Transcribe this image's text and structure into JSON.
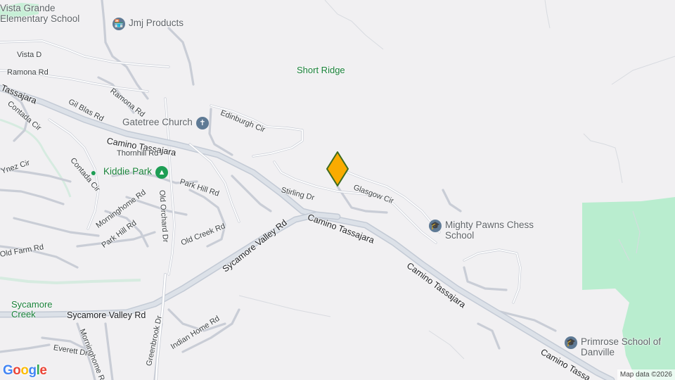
{
  "map": {
    "colors": {
      "background": "#f1f0f2",
      "road": "#ffffff",
      "road_casing": "#c9cdd6",
      "major_road": "#c9d0da",
      "park": "#b9edcf",
      "stream": "#d6ebe0",
      "marker_fill": "#f9ab00",
      "marker_stroke": "#3e6b1f"
    },
    "streets": {
      "vista": "Vista D",
      "ramona1": "Ramona Rd",
      "tassajara_top": "Tassajara",
      "contada1": "Contada Cir",
      "gil_blas": "Gil Blas Rd",
      "ramona2": "Ramona Rd",
      "edinburgh": "Edinburgh Cir",
      "tassajara_west": "Camino Tassajara",
      "thornhill": "Thornhill Rd",
      "contada2": "Contada Cir",
      "ynez": "Ynez Cir",
      "park_hill1": "Park Hill Rd",
      "stirling": "Stirling Dr",
      "glasgow": "Glasgow Cir",
      "tassajara_mid": "Camino Tassajara",
      "sycamore_valley_diag": "Sycamore Valley Rd",
      "morninghome1": "Morninghome Rd",
      "old_orchard": "Old Orchard Dr",
      "park_hill2": "Park Hill Rd",
      "old_creek": "Old Creek Rd",
      "old_farm": "Old Farm Rd",
      "tassajara_east": "Camino Tassajara",
      "sycamore_valley": "Sycamore Valley Rd",
      "greenbrook": "Greenbrook Dr",
      "morninghome2": "Morninghome Rd",
      "indian_home": "Indian Home Rd",
      "everett": "Everett Dr",
      "tassajara_se": "Camino Tassa"
    },
    "places": {
      "school1": "Vista Grande Elementary School",
      "jmj": "Jmj Products",
      "church": "Gatetree Church",
      "kiddie_park": "Kiddie Park",
      "mighty_pawns": "Mighty Pawns Chess School",
      "primrose": "Primrose School of Danville"
    },
    "areas": {
      "short_ridge": "Short Ridge",
      "sycamore_creek": "Sycamore Creek"
    },
    "icons": {
      "school": "school-icon",
      "shopping": "shopping-bag-icon",
      "church": "church-icon",
      "park": "tree-icon",
      "marker": "location-marker-icon"
    },
    "attribution": "Map data ©2026",
    "logo": "Google"
  }
}
